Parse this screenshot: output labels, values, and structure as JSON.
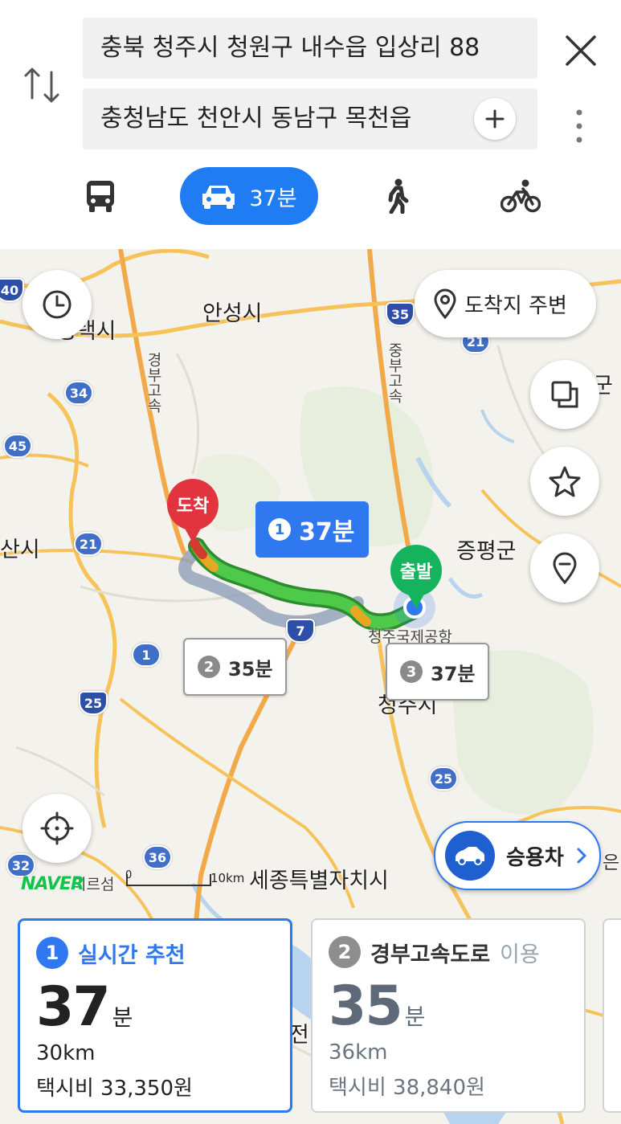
{
  "search": {
    "origin": "충북 청주시 청원구 내수읍 입상리 88",
    "destination": "충청남도 천안시 동남구 목천읍"
  },
  "modes": [
    {
      "name": "bus",
      "icon": "bus-icon"
    },
    {
      "name": "car",
      "icon": "car-icon",
      "label": "37분",
      "selected": true
    },
    {
      "name": "walk",
      "icon": "walk-icon"
    },
    {
      "name": "bike",
      "icon": "bicycle-icon"
    }
  ],
  "map": {
    "labels": {
      "anseong": "안성시",
      "pyeongtaek": "평택시",
      "jeungpyeong": "증평군",
      "sejong": "세종특별자치시",
      "airport": "청주국제공항",
      "cheongju": "청주시",
      "si_left": "산시",
      "gun_right": "군",
      "mireusa": "미르섬",
      "expressway_a": "경부고속",
      "expressway_b": "중부고속",
      "eun": "은",
      "jeon": "전"
    },
    "shields": [
      "40",
      "35",
      "21",
      "34",
      "45",
      "21",
      "1",
      "25",
      "25",
      "32",
      "36",
      "7"
    ],
    "nearby_button": "도착지 주변",
    "vehicle_button": "승용차",
    "brand": "NAVER",
    "scale": {
      "start": "0",
      "end": "10km"
    },
    "pins": {
      "arrival": "도착",
      "departure": "출발"
    },
    "callouts": {
      "route1": {
        "num": "1",
        "time": "37분"
      },
      "route2": {
        "num": "2",
        "time": "35분"
      },
      "route3": {
        "num": "3",
        "time": "37분"
      }
    }
  },
  "routes": [
    {
      "num": "1",
      "title": "실시간 추천",
      "suffix": "",
      "minutes": "37",
      "unit": "분",
      "distance": "30km",
      "fare": "택시비 33,350원"
    },
    {
      "num": "2",
      "title": "경부고속도로",
      "suffix": "이용",
      "minutes": "35",
      "unit": "분",
      "distance": "36km",
      "fare": "택시비 38,840원"
    }
  ],
  "colors": {
    "accent": "#2f78f0",
    "route_green": "#3cb043",
    "arrival_pin": "#e2343f",
    "departure_pin": "#16b35e",
    "brand": "#11c54b"
  }
}
